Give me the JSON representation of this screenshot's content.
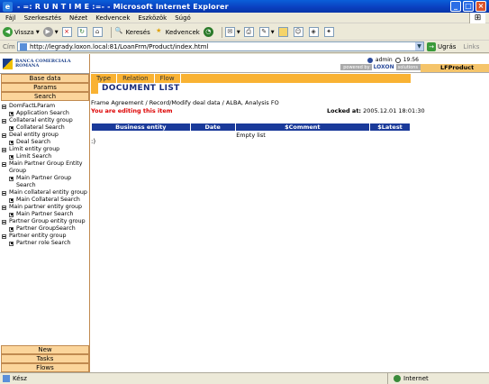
{
  "window": {
    "title": "- =: R U N T I M E :=- - Microsoft Internet Explorer"
  },
  "menu": [
    "Fájl",
    "Szerkesztés",
    "Nézet",
    "Kedvencek",
    "Eszközök",
    "Súgó"
  ],
  "toolbar": {
    "back_label": "Vissza",
    "search_label": "Keresés",
    "favorites_label": "Kedvencek"
  },
  "address": {
    "label": "Cím",
    "url": "http://legrady.loxon.local:81/LoanFrm/Product/index.html",
    "go_label": "Ugrás",
    "links_label": "Links"
  },
  "app": {
    "logo_text": "BANCA COMERCIALA ROMANA",
    "user": "admin",
    "time": "19:56",
    "powered_by": "powered by",
    "brand": "LOXON",
    "brand_suffix": "solutions",
    "product": "LFProduct"
  },
  "sidebar": {
    "top_buttons": [
      "Base data",
      "Params",
      "Search"
    ],
    "tree": [
      {
        "label": "DomFactLParam",
        "level": 0
      },
      {
        "label": "Application Search",
        "level": 1
      },
      {
        "label": "Collateral entity group",
        "level": 0
      },
      {
        "label": "Collateral Search",
        "level": 1
      },
      {
        "label": "Deal entity group",
        "level": 0
      },
      {
        "label": "Deal Search",
        "level": 1
      },
      {
        "label": "Limit entity group",
        "level": 0
      },
      {
        "label": "Limit Search",
        "level": 1
      },
      {
        "label": "Main Partner Group Entity Group",
        "level": 0
      },
      {
        "label": "Main Partner Group Search",
        "level": 1
      },
      {
        "label": "Main collateral entity group",
        "level": 0
      },
      {
        "label": "Main Collateral Search",
        "level": 1
      },
      {
        "label": "Main partner entity group",
        "level": 0
      },
      {
        "label": "Main Partner Search",
        "level": 1
      },
      {
        "label": "Partner Group entity group",
        "level": 0
      },
      {
        "label": "Partner GroupSearch",
        "level": 1
      },
      {
        "label": "Partner entity group",
        "level": 0
      },
      {
        "label": "Partner role Search",
        "level": 1
      }
    ],
    "bottom_buttons": [
      "New",
      "Tasks",
      "Flows"
    ]
  },
  "content": {
    "tabs": [
      "Type",
      "Relation",
      "Flow"
    ],
    "title": "DOCUMENT LIST",
    "breadcrumb": "Frame Agreement / Record/Modify deal data /  ALBA, Analysis FO",
    "editing": "You are editing this item",
    "locked_label": "Locked at:",
    "locked_value": "2005.12.01 18:01:30",
    "table": {
      "headers": [
        "Business entity",
        "Date",
        "$Comment",
        "$Latest"
      ],
      "empty": "Empty list"
    },
    "footer_mark": ":)"
  },
  "status": {
    "text": "Kész",
    "zone": "Internet"
  }
}
